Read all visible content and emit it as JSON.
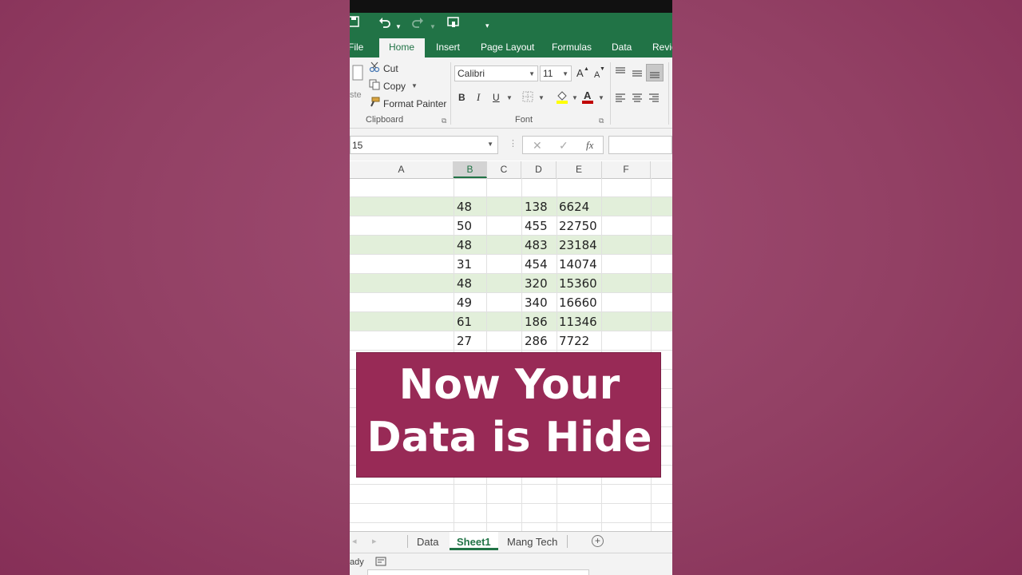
{
  "quick_access": {
    "save_icon": "save-icon",
    "undo_icon": "undo-icon",
    "redo_icon": "redo-icon",
    "touch_icon": "touch-mode-icon",
    "customize_icon": "customize-qat-icon"
  },
  "tabs": [
    "File",
    "Home",
    "Insert",
    "Page Layout",
    "Formulas",
    "Data",
    "Revie"
  ],
  "clipboard": {
    "paste_label": "ste",
    "cut": "Cut",
    "copy": "Copy",
    "format_painter": "Format Painter",
    "group_label": "Clipboard"
  },
  "font": {
    "name": "Calibri",
    "size": "11",
    "bold": "B",
    "italic": "I",
    "underline": "U",
    "grow": "A",
    "shrink": "A",
    "group_label": "Font"
  },
  "formula_bar": {
    "name_box": "15",
    "fx": "fx"
  },
  "columns": [
    "A",
    "B",
    "C",
    "D",
    "E",
    "F"
  ],
  "rows": [
    {
      "b": "",
      "d": "",
      "e": ""
    },
    {
      "b": "48",
      "d": "138",
      "e": "6624"
    },
    {
      "b": "50",
      "d": "455",
      "e": "22750"
    },
    {
      "b": "48",
      "d": "483",
      "e": "23184"
    },
    {
      "b": "31",
      "d": "454",
      "e": "14074"
    },
    {
      "b": "48",
      "d": "320",
      "e": "15360"
    },
    {
      "b": "49",
      "d": "340",
      "e": "16660"
    },
    {
      "b": "61",
      "d": "186",
      "e": "11346"
    },
    {
      "b": "27",
      "d": "286",
      "e": "7722"
    }
  ],
  "overlay": {
    "line1": "Now Your",
    "line2": "Data is Hide"
  },
  "sheets": [
    "Data",
    "Sheet1",
    "Mang Tech"
  ],
  "status": {
    "text": "ady"
  },
  "colors": {
    "excel_green": "#217346",
    "band": "#e2efda",
    "overlay": "#982a56",
    "background": "#924064"
  }
}
